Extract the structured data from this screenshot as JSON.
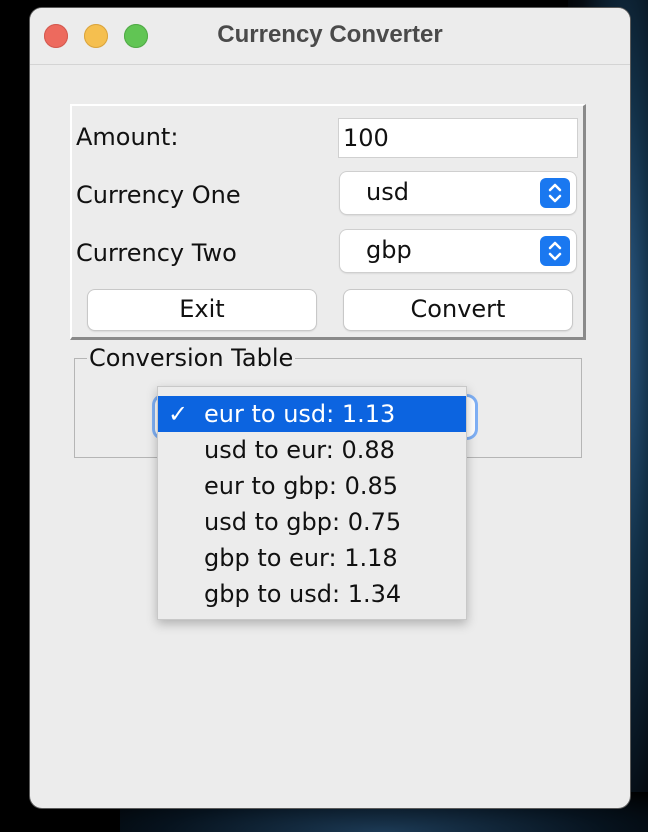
{
  "window": {
    "title": "Currency Converter"
  },
  "form": {
    "amount_label": "Amount:",
    "amount_value": "100",
    "currency_one_label": "Currency One",
    "currency_one_value": "usd",
    "currency_two_label": "Currency Two",
    "currency_two_value": "gbp",
    "exit_label": "Exit",
    "convert_label": "Convert"
  },
  "conversion_table": {
    "title": "Conversion Table",
    "check_glyph": "✓",
    "options": [
      {
        "label": "eur to usd: 1.13",
        "selected": true
      },
      {
        "label": "usd to eur: 0.88",
        "selected": false
      },
      {
        "label": "eur to gbp: 0.85",
        "selected": false
      },
      {
        "label": "usd to gbp: 0.75",
        "selected": false
      },
      {
        "label": "gbp to eur: 1.18",
        "selected": false
      },
      {
        "label": "gbp to usd: 1.34",
        "selected": false
      }
    ]
  },
  "colors": {
    "selection": "#0c64e0",
    "stepper": "#1a78f0",
    "close": "#ed6a5e",
    "minimize": "#f5bf4f",
    "maximize": "#61c554"
  }
}
